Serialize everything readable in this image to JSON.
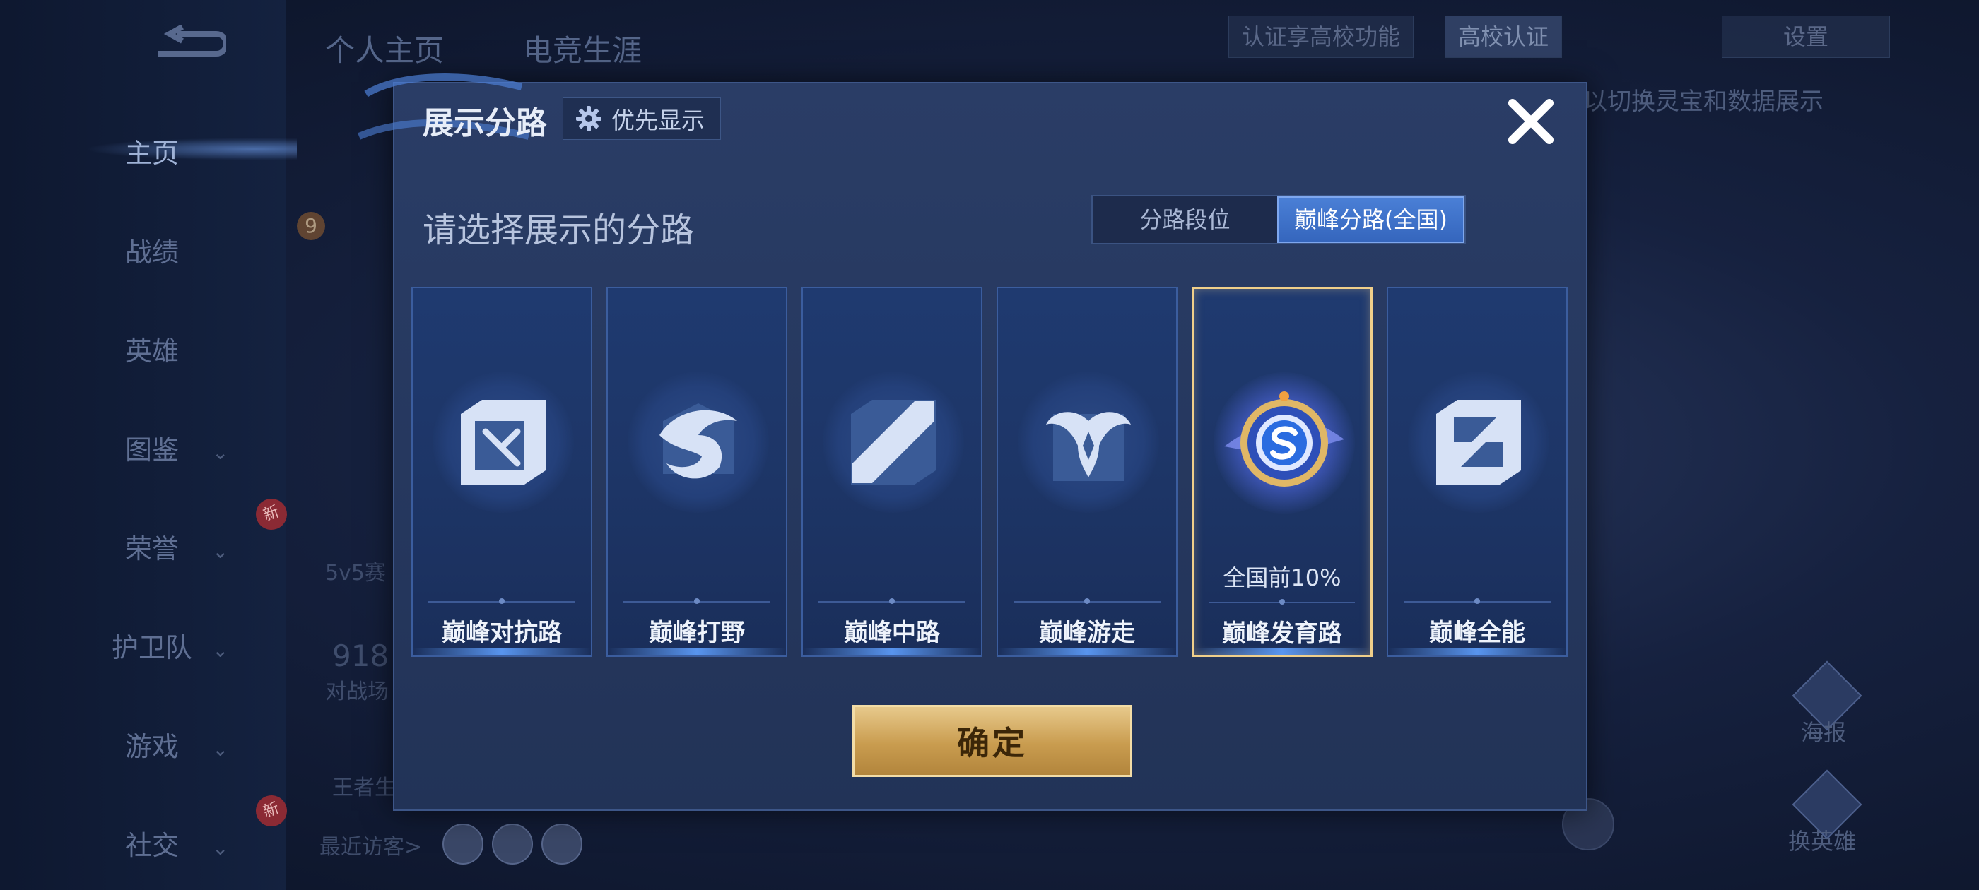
{
  "background": {
    "sidebar": {
      "items": [
        {
          "label": "主页",
          "has_chevron": false
        },
        {
          "label": "战绩",
          "has_chevron": false
        },
        {
          "label": "英雄",
          "has_chevron": false
        },
        {
          "label": "图鉴",
          "has_chevron": true
        },
        {
          "label": "荣誉",
          "has_chevron": true
        },
        {
          "label": "护卫队",
          "has_chevron": true
        },
        {
          "label": "游戏",
          "has_chevron": true
        },
        {
          "label": "社交",
          "has_chevron": true
        }
      ],
      "new_badge": "新"
    },
    "top_tabs": [
      "个人主页",
      "电竞生涯"
    ],
    "verify_hint": "认证享高校功能",
    "verify_button": "高校认证",
    "settings": "设置",
    "hint_text": "以切换灵宝和数据展示",
    "level_badge": "9",
    "mode_text": "5v5赛",
    "stat_value": "918",
    "stat_label": "对战场",
    "king_text": "王者生",
    "recent_visitors": "最近访客>",
    "poster": "海报",
    "switch_hero": "换英雄"
  },
  "modal": {
    "title": "展示分路",
    "priority_label": "优先显示",
    "subtitle": "请选择展示的分路",
    "toggle": {
      "options": [
        "分路段位",
        "巅峰分路(全国)"
      ],
      "selected": 1
    },
    "cards": [
      {
        "name": "巅峰对抗路",
        "icon": "sword-icon",
        "rank": "",
        "selected": false
      },
      {
        "name": "巅峰打野",
        "icon": "dragon-icon",
        "rank": "",
        "selected": false
      },
      {
        "name": "巅峰中路",
        "icon": "blade-icon",
        "rank": "",
        "selected": false
      },
      {
        "name": "巅峰游走",
        "icon": "wings-icon",
        "rank": "",
        "selected": false
      },
      {
        "name": "巅峰发育路",
        "icon": "emblem-icon",
        "rank": "全国前10%",
        "selected": true
      },
      {
        "name": "巅峰全能",
        "icon": "all-round-icon",
        "rank": "",
        "selected": false
      }
    ],
    "confirm_label": "确定"
  },
  "colors": {
    "accent_gold": "#f0cf8a",
    "toggle_selected": "#3f74cc",
    "card_bg": "#1f3a70"
  }
}
